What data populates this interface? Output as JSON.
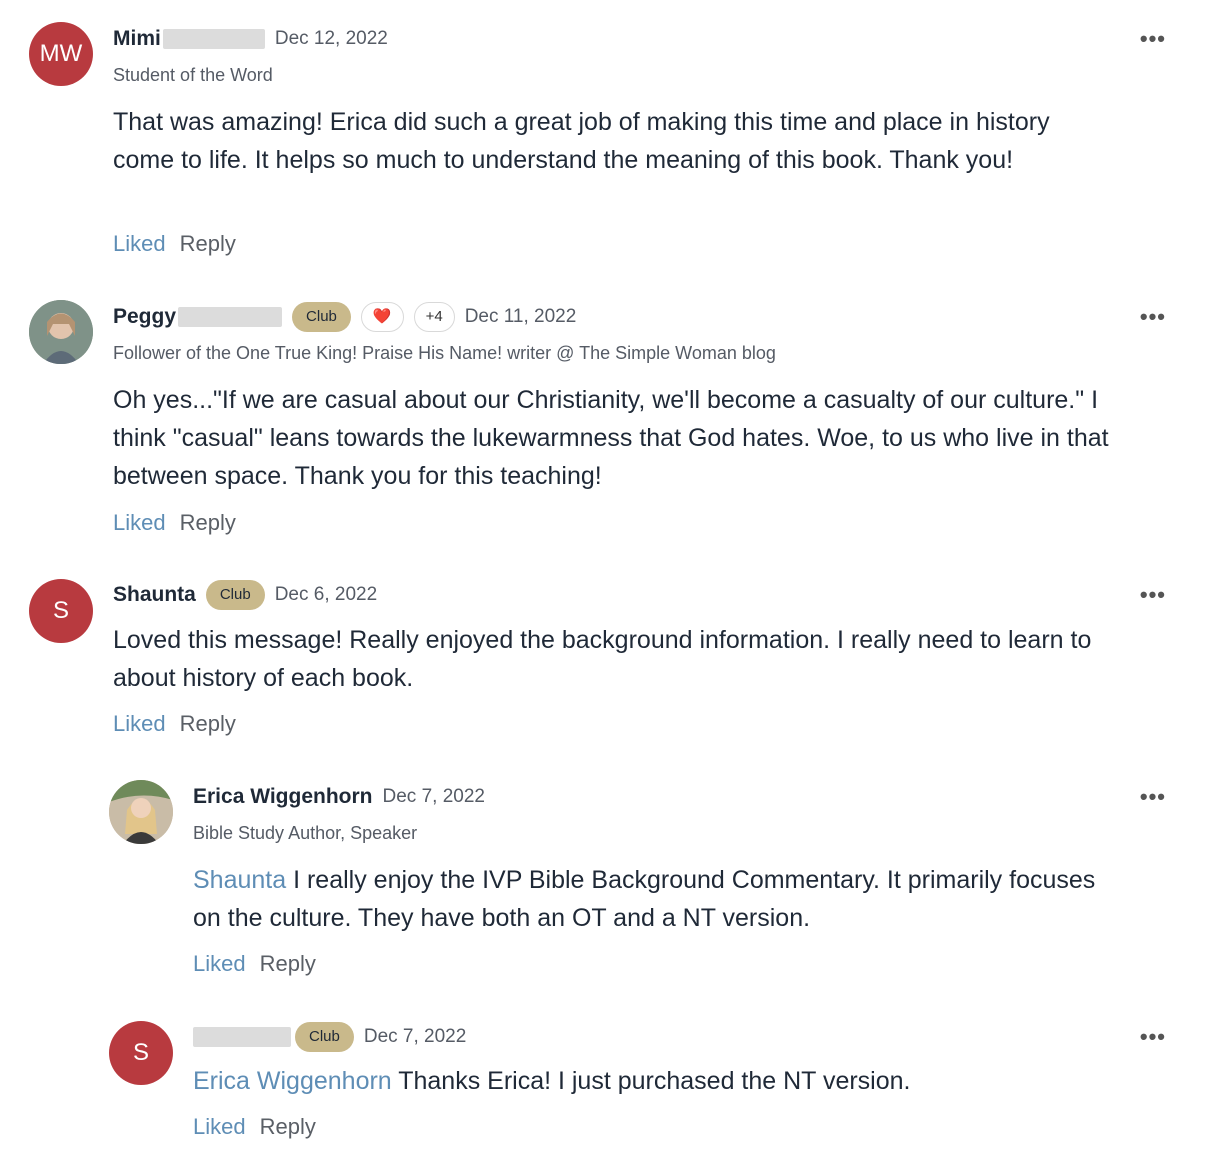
{
  "comments": [
    {
      "avatar_initials": "MW",
      "name": "Mimi",
      "date": "Dec 12, 2022",
      "subtitle": "Student of the Word",
      "body": "That was amazing! Erica did such a great job of making this time and place in history come to life. It helps so much to understand the meaning of this book. Thank you!",
      "liked_label": "Liked",
      "reply_label": "Reply",
      "more_label": "•••"
    },
    {
      "name": "Peggy",
      "badge": "Club",
      "reaction": "❤️",
      "reaction_more": "+4",
      "date": "Dec 11, 2022",
      "subtitle": "Follower of the One True King! Praise His Name! writer @ The Simple Woman blog",
      "body": "Oh yes...\"If we are casual about our Christianity, we'll become a casualty of our culture.\" I think \"casual\" leans towards the lukewarmness that God hates. Woe, to us who live in that between space. Thank you for this teaching!",
      "liked_label": "Liked",
      "reply_label": "Reply",
      "more_label": "•••"
    },
    {
      "avatar_initials": "S",
      "name": "Shaunta",
      "badge": "Club",
      "date": "Dec 6, 2022",
      "body": "Loved this message!   Really enjoyed the background information. I really need to learn to about history of each book.",
      "liked_label": "Liked",
      "reply_label": "Reply",
      "more_label": "•••"
    },
    {
      "name": "Erica Wiggenhorn",
      "date": "Dec 7, 2022",
      "subtitle": "Bible Study Author, Speaker",
      "mention": "Shaunta",
      "body": " I really enjoy the IVP Bible Background Commentary. It primarily focuses on the culture. They have both an OT and a NT version.",
      "liked_label": "Liked",
      "reply_label": "Reply",
      "more_label": "•••"
    },
    {
      "avatar_initials": "S",
      "badge": "Club",
      "date": "Dec 7, 2022",
      "mention": "Erica Wiggenhorn",
      "body": " Thanks Erica! I just purchased the NT version.",
      "liked_label": "Liked",
      "reply_label": "Reply",
      "more_label": "•••"
    }
  ],
  "colors": {
    "avatar_red": "#b83a3f",
    "badge_gold": "#c9b98b",
    "link_blue": "#5e8db5"
  }
}
